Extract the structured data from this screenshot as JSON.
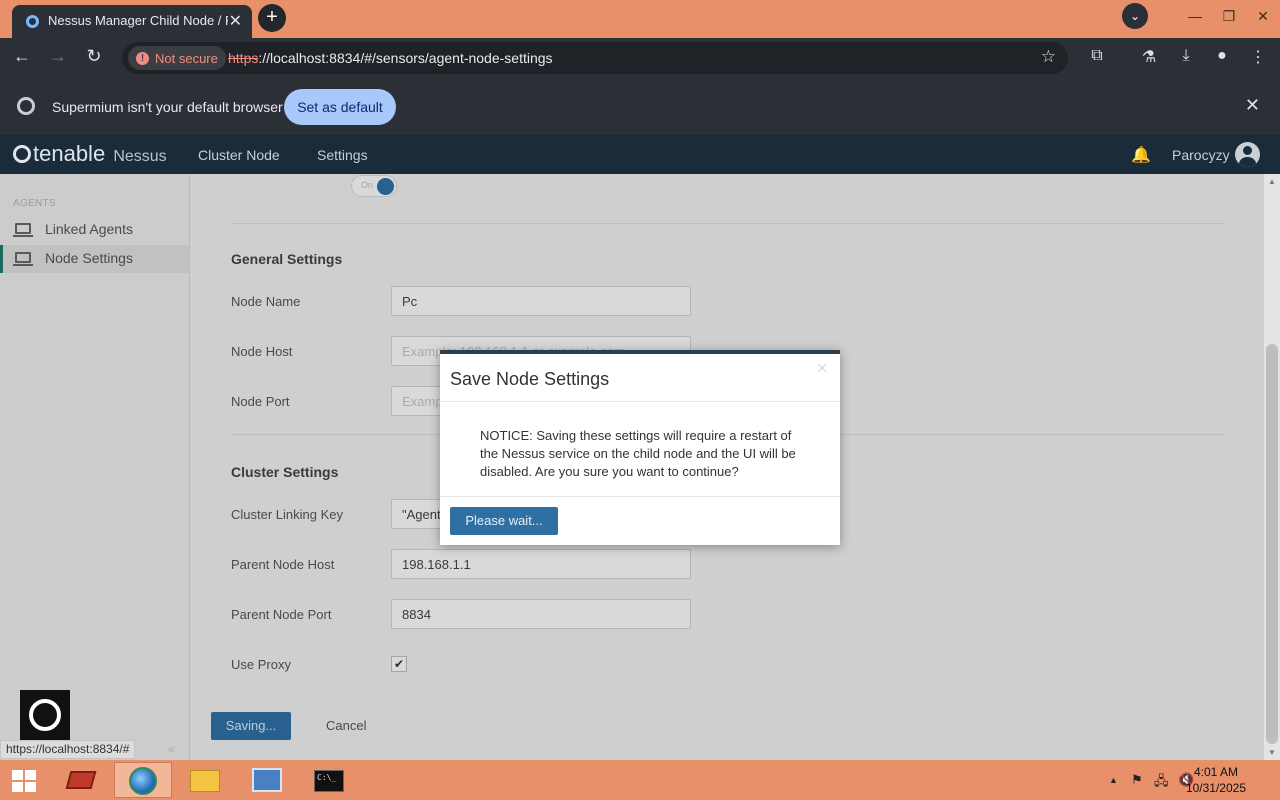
{
  "browser": {
    "tab_title": "Nessus Manager Child Node / P",
    "tab_close": "✕",
    "new_tab": "+",
    "not_secure": "Not secure",
    "url_scheme": "https",
    "url_rest": "://localhost:8834/#/sensors/agent-node-settings",
    "infobar_message": "Supermium isn't your default browser",
    "set_default_label": "Set as default"
  },
  "app": {
    "brand": "tenable",
    "brand_product": "Nessus",
    "nav": [
      "Cluster Node",
      "Settings"
    ],
    "username": "Parocyzy"
  },
  "sidebar": {
    "section": "AGENTS",
    "items": [
      {
        "label": "Linked Agents",
        "active": false
      },
      {
        "label": "Node Settings",
        "active": true
      }
    ]
  },
  "form": {
    "toggle_label": "On",
    "general_title": "General Settings",
    "node_name_label": "Node Name",
    "node_name_value": "Pc",
    "node_host_label": "Node Host",
    "node_host_placeholder": "Example: 192.168.1.1 or example.com",
    "node_port_label": "Node Port",
    "node_port_placeholder": "Example: 8834",
    "cluster_title": "Cluster Settings",
    "linking_key_label": "Cluster Linking Key",
    "linking_key_value": "\"Agent",
    "parent_host_label": "Parent Node Host",
    "parent_host_value": "198.168.1.1",
    "parent_port_label": "Parent Node Port",
    "parent_port_value": "8834",
    "use_proxy_label": "Use Proxy",
    "use_proxy_checked": true,
    "saving_label": "Saving...",
    "cancel_label": "Cancel"
  },
  "dialog": {
    "title": "Save Node Settings",
    "message": "NOTICE: Saving these settings will require a restart of the Nessus service on the child node and the UI will be disabled. Are you sure you want to continue?",
    "button_label": "Please wait..."
  },
  "status_url": "https://localhost:8834/#",
  "taskbar": {
    "time": "4:01 AM",
    "date": "10/31/2025"
  },
  "colors": {
    "accent": "#2e6fa4",
    "app_header": "#1a2b3a",
    "browser_frame": "#e8906a"
  }
}
